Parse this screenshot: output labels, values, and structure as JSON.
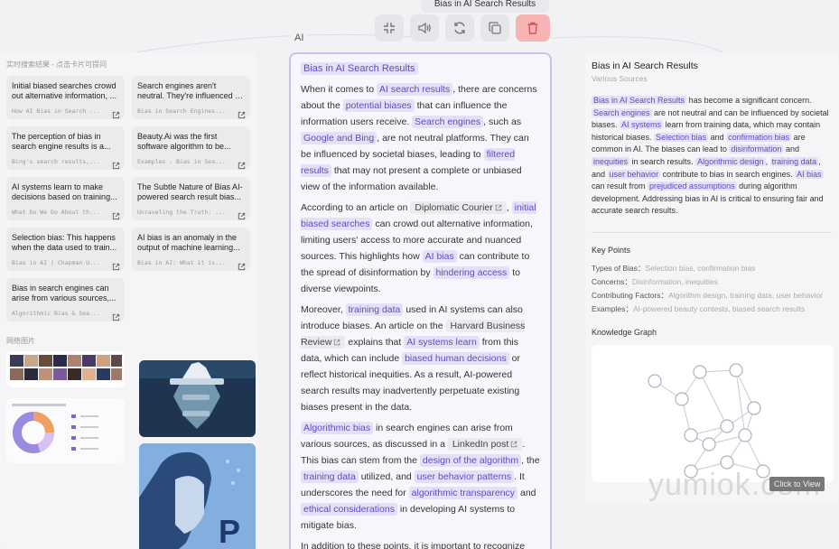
{
  "toolbar": {
    "title": "Bias in AI Search Results",
    "buttons": [
      {
        "name": "collapse-icon"
      },
      {
        "name": "speaker-icon"
      },
      {
        "name": "refresh-icon"
      },
      {
        "name": "copy-icon"
      },
      {
        "name": "trash-icon"
      }
    ]
  },
  "ai_tag": "AI",
  "left": {
    "search_results_label": "实时搜索结果 - 点击卡片可提问",
    "cards": [
      {
        "title": "Initial biased searches crowd out alternative information, ...",
        "source": "How AI Bias in Search ..."
      },
      {
        "title": "Search engines aren't neutral. They're influenced by the...",
        "source": "Bias in Search Engines..."
      },
      {
        "title": "The perception of bias in search engine results is a...",
        "source": "Bing's search results,..."
      },
      {
        "title": "Beauty.Ai was the first software algorithm to be...",
        "source": "Examples - Bias in Sea..."
      },
      {
        "title": "AI systems learn to make decisions based on training...",
        "source": "What Do We Do About th..."
      },
      {
        "title": "The Subtle Nature of Bias AI-powered search result bias...",
        "source": "Unraveling the Truth: ..."
      },
      {
        "title": "Selection bias: This happens when the data used to train...",
        "source": "Bias in AI | Chapman U..."
      },
      {
        "title": "AI bias is an anomaly in the output of machine learning...",
        "source": "Bias in AI: What it is..."
      },
      {
        "title": "Bias in search engines can arise from various sources,...",
        "source": "Algorithmic Bias & Sea..."
      }
    ],
    "web_images_label": "网络图片",
    "images": [
      {
        "name": "faces-grid-image"
      },
      {
        "name": "iceberg-image"
      },
      {
        "name": "donut-chart-image"
      },
      {
        "name": "robot-face-image"
      }
    ]
  },
  "middle": {
    "title": "Bias in AI Search Results",
    "paragraphs": [
      [
        {
          "t": "When it comes to "
        },
        {
          "t": "AI search results",
          "h": true
        },
        {
          "t": ", there are concerns about the "
        },
        {
          "t": "potential biases",
          "h": true
        },
        {
          "t": " that can influence the information users receive. "
        },
        {
          "t": "Search engines",
          "h": true
        },
        {
          "t": ", such as "
        },
        {
          "t": "Google and Bing",
          "h": true
        },
        {
          "t": ", are not neutral platforms. They can be influenced by societal biases, leading to "
        },
        {
          "t": "filtered results",
          "h": true
        },
        {
          "t": " that may not present a complete or unbiased view of the information available."
        }
      ],
      [
        {
          "t": "According to an article on "
        },
        {
          "t": "Diplomatic Courier",
          "s": true
        },
        {
          "t": ", "
        },
        {
          "t": "initial biased searches",
          "h": true
        },
        {
          "t": " can crowd out alternative information, limiting users' access to more accurate and nuanced sources. This highlights how "
        },
        {
          "t": "AI bias",
          "h": true
        },
        {
          "t": " can contribute to the spread of disinformation by "
        },
        {
          "t": "hindering access",
          "h": true
        },
        {
          "t": " to diverse viewpoints."
        }
      ],
      [
        {
          "t": "Moreover, "
        },
        {
          "t": "training data",
          "h": true
        },
        {
          "t": " used in AI systems can also introduce biases. An article on the "
        },
        {
          "t": "Harvard Business Review",
          "s": true
        },
        {
          "t": " explains that "
        },
        {
          "t": "AI systems learn",
          "h": true
        },
        {
          "t": " from this data, which can include "
        },
        {
          "t": "biased human decisions",
          "h": true
        },
        {
          "t": " or reflect historical inequities. As a result, AI-powered search results may inadvertently perpetuate existing biases present in the data."
        }
      ],
      [
        {
          "t": "Algorithmic bias",
          "h": true
        },
        {
          "t": " in search engines can arise from various sources, as discussed in a "
        },
        {
          "t": "LinkedIn post",
          "s": true
        },
        {
          "t": ". This bias can stem from the "
        },
        {
          "t": "design of the algorithm",
          "h": true
        },
        {
          "t": ", the "
        },
        {
          "t": "training data",
          "h": true
        },
        {
          "t": " utilized, and "
        },
        {
          "t": "user behavior patterns",
          "h": true
        },
        {
          "t": ". It underscores the need for "
        },
        {
          "t": "algorithmic transparency",
          "h": true
        },
        {
          "t": " and "
        },
        {
          "t": "ethical considerations",
          "h": true
        },
        {
          "t": " in developing AI systems to mitigate bias."
        }
      ],
      [
        {
          "t": "In addition to these points, it is important to recognize"
        }
      ]
    ]
  },
  "right": {
    "title": "Bias in AI Search Results",
    "subtitle": "Various Sources",
    "summary": [
      {
        "t": "Bias in AI Search Results",
        "h": true
      },
      {
        "t": " has become a significant concern. "
      },
      {
        "t": "Search engines",
        "h": true
      },
      {
        "t": " are not neutral and can be influenced by societal biases. "
      },
      {
        "t": "AI systems",
        "h": true
      },
      {
        "t": " learn from training data, which may contain historical biases. "
      },
      {
        "t": "Selection bias",
        "h": true
      },
      {
        "t": " and "
      },
      {
        "t": "confirmation bias",
        "h": true
      },
      {
        "t": " are common in AI. The biases can lead to "
      },
      {
        "t": "disinformation",
        "h": true
      },
      {
        "t": " and "
      },
      {
        "t": "inequities",
        "h": true
      },
      {
        "t": " in search results. "
      },
      {
        "t": "Algorithmic design",
        "h": true
      },
      {
        "t": ", "
      },
      {
        "t": "training data",
        "h": true
      },
      {
        "t": ", and "
      },
      {
        "t": "user behavior",
        "h": true
      },
      {
        "t": " contribute to bias in search engines. "
      },
      {
        "t": "AI bias",
        "h": true
      },
      {
        "t": " can result from "
      },
      {
        "t": "prejudiced assumptions",
        "h": true
      },
      {
        "t": " during algorithm development. Addressing bias in AI is critical to ensuring fair and accurate search results."
      }
    ],
    "key_points_title": "Key Points",
    "key_points": [
      {
        "label": "Types of Bias：",
        "value": "Selection bias, confirmation bias"
      },
      {
        "label": "Concerns：",
        "value": "Disinformation, inequities"
      },
      {
        "label": "Contributing Factors：",
        "value": "Algorithm design, training data, user behavior"
      },
      {
        "label": "Examples：",
        "value": "AI-powered beauty contests, biased search results"
      }
    ],
    "knowledge_graph_title": "Knowledge Graph",
    "click_to_view": "Click to View"
  },
  "watermark": "yumiok.com"
}
